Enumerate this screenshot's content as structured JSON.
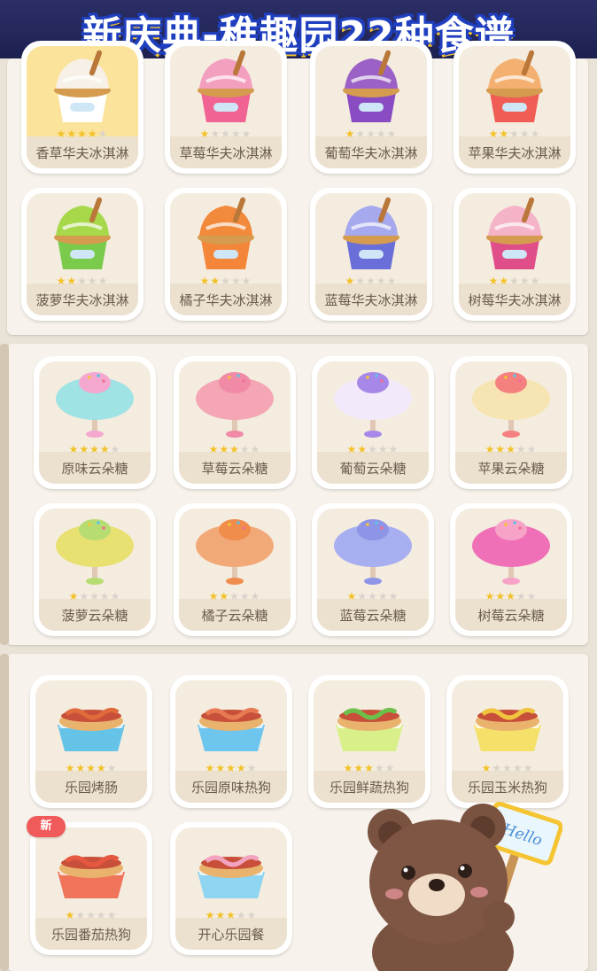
{
  "banner": {
    "title": "新庆典-稚趣园22种食谱"
  },
  "badge_new": "新",
  "sign_text": "Hello",
  "sections": [
    {
      "name": "ice-cream",
      "items": [
        {
          "label": "香草华夫冰淇淋",
          "stars": 4,
          "color": "#f6f0e6",
          "cup": "#ffffff",
          "selected": true
        },
        {
          "label": "草莓华夫冰淇淋",
          "stars": 1,
          "color": "#f39fc0",
          "cup": "#f06392",
          "selected": false
        },
        {
          "label": "葡萄华夫冰淇淋",
          "stars": 1,
          "color": "#9b61c6",
          "cup": "#8a4cc2",
          "selected": false
        },
        {
          "label": "苹果华夫冰淇淋",
          "stars": 2,
          "color": "#f3b070",
          "cup": "#ef5d54",
          "selected": false
        },
        {
          "label": "菠萝华夫冰淇淋",
          "stars": 2,
          "color": "#a6d84a",
          "cup": "#7acb4c",
          "selected": false
        },
        {
          "label": "橘子华夫冰淇淋",
          "stars": 2,
          "color": "#f28a3c",
          "cup": "#f4863a",
          "selected": false
        },
        {
          "label": "蓝莓华夫冰淇淋",
          "stars": 1,
          "color": "#a6a9ee",
          "cup": "#6a6ed8",
          "selected": false
        },
        {
          "label": "树莓华夫冰淇淋",
          "stars": 2,
          "color": "#f5b3c8",
          "cup": "#e04e8a",
          "selected": false
        }
      ]
    },
    {
      "name": "cotton-candy",
      "items": [
        {
          "label": "原味云朵糖",
          "stars": 4,
          "color": "#9fe3e4",
          "top": "#f4a8d0"
        },
        {
          "label": "草莓云朵糖",
          "stars": 3,
          "color": "#f4a6b4",
          "top": "#f08aa6"
        },
        {
          "label": "葡萄云朵糖",
          "stars": 2,
          "color": "#f2eafa",
          "top": "#a788e8"
        },
        {
          "label": "苹果云朵糖",
          "stars": 3,
          "color": "#f6e5b2",
          "top": "#f48080"
        },
        {
          "label": "菠萝云朵糖",
          "stars": 1,
          "color": "#e8e070",
          "top": "#b7dc72"
        },
        {
          "label": "橘子云朵糖",
          "stars": 2,
          "color": "#f2a978",
          "top": "#f08c4c"
        },
        {
          "label": "蓝莓云朵糖",
          "stars": 1,
          "color": "#a8aff0",
          "top": "#8e95e6"
        },
        {
          "label": "树莓云朵糖",
          "stars": 3,
          "color": "#f070b8",
          "top": "#f7a3c8"
        }
      ]
    },
    {
      "name": "hot-dog",
      "items": [
        {
          "label": "乐园烤肠",
          "stars": 4,
          "tray": "#66c3e8",
          "food": "#e06a3a"
        },
        {
          "label": "乐园原味热狗",
          "stars": 4,
          "tray": "#6ec6ef",
          "food": "#e77a52"
        },
        {
          "label": "乐园鲜蔬热狗",
          "stars": 3,
          "tray": "#d9f08a",
          "food": "#6cc04a"
        },
        {
          "label": "乐园玉米热狗",
          "stars": 1,
          "tray": "#f5e06a",
          "food": "#f0c43c"
        },
        {
          "label": "乐园番茄热狗",
          "stars": 1,
          "tray": "#f0745a",
          "food": "#e65840"
        },
        {
          "label": "开心乐园餐",
          "stars": 3,
          "tray": "#8fd4f0",
          "food": "#f3a3c0"
        }
      ]
    }
  ]
}
